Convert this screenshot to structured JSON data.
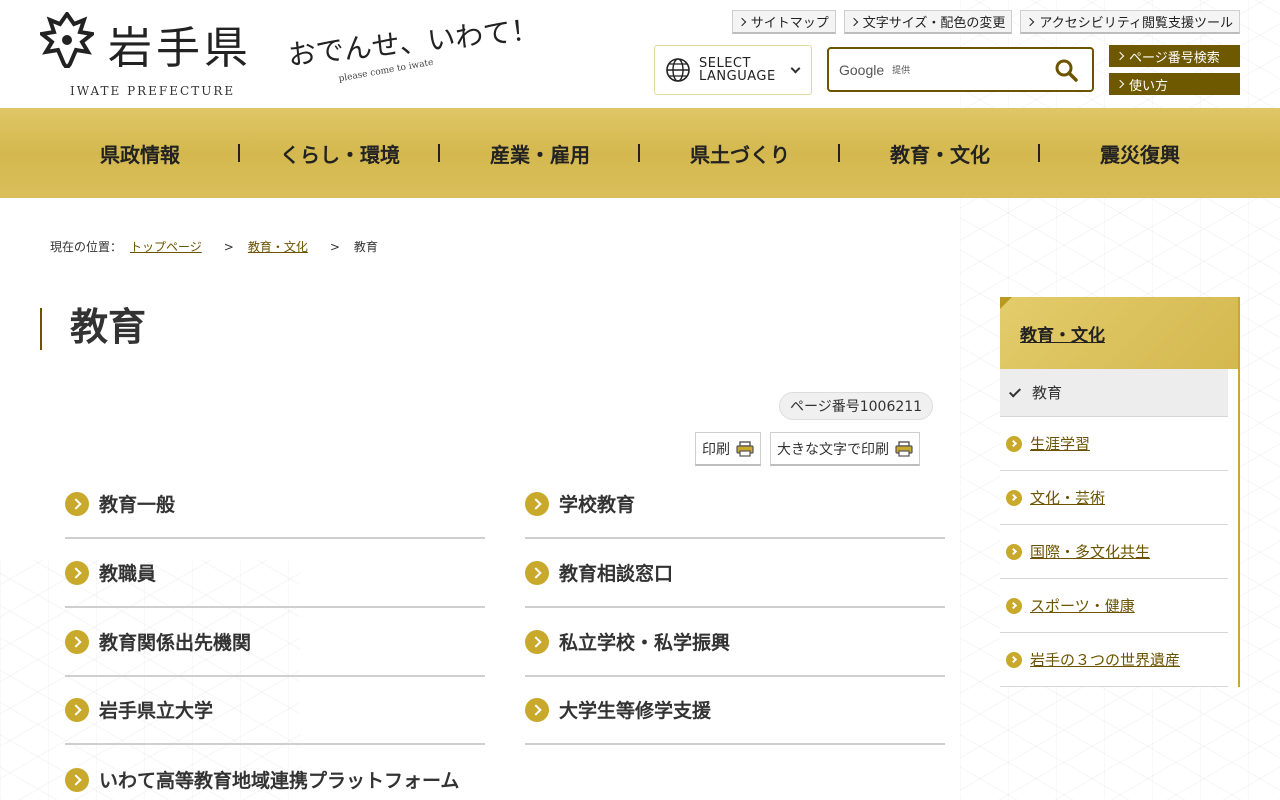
{
  "header": {
    "logo_title": "岩手県",
    "logo_sub": "IWATE PREFECTURE",
    "slogan": "おでんせ、いわて！",
    "slogan_en": "please come to iwate",
    "util_links": [
      "サイトマップ",
      "文字サイズ・配色の変更",
      "アクセシビリティ閲覧支援ツール"
    ],
    "lang_line1": "SELECT",
    "lang_line2": "LANGUAGE",
    "search_google": "Google",
    "search_provided": "提供",
    "side_buttons": [
      "ページ番号検索",
      "使い方"
    ]
  },
  "nav": {
    "items": [
      "県政情報",
      "くらし・環境",
      "産業・雇用",
      "県土づくり",
      "教育・文化",
      "震災復興"
    ]
  },
  "breadcrumb": {
    "label": "現在の位置：",
    "items": [
      "トップページ",
      "教育・文化",
      "教育"
    ]
  },
  "page": {
    "title": "教育",
    "page_number": "ページ番号1006211",
    "print_label": "印刷",
    "print_large_label": "大きな文字で印刷"
  },
  "links": [
    "教育一般",
    "学校教育",
    "教職員",
    "教育相談窓口",
    "教育関係出先機関",
    "私立学校・私学振興",
    "岩手県立大学",
    "大学生等修学支援",
    "いわて高等教育地域連携プラットフォーム"
  ],
  "sidebar": {
    "heading": "教育・文化",
    "items": [
      "教育",
      "生涯学習",
      "文化・芸術",
      "国際・多文化共生",
      "スポーツ・健康",
      "岩手の３つの世界遺産"
    ]
  },
  "colors": {
    "gold": "#d4b84f",
    "brown": "#6b5300",
    "accent_circle": "#c8a92c"
  }
}
